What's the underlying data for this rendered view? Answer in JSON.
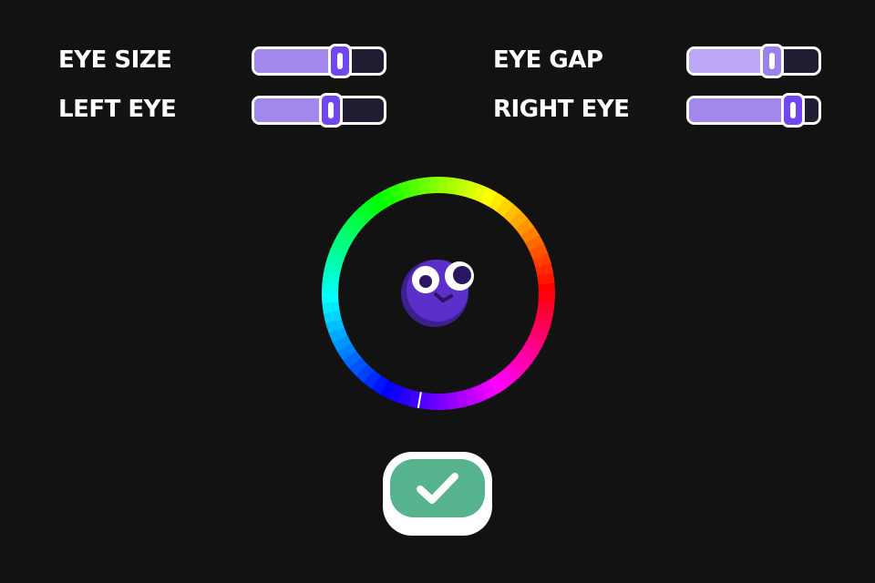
{
  "sliders": [
    {
      "id": "eye-size",
      "label": "EYE SIZE",
      "value": 0.66
    },
    {
      "id": "eye-gap",
      "label": "EYE GAP",
      "value": 0.64
    },
    {
      "id": "left-eye",
      "label": "LEFT EYE",
      "value": 0.59
    },
    {
      "id": "right-eye",
      "label": "RIGHT EYE",
      "value": 0.8
    }
  ],
  "color_wheel": {
    "selected_hue_deg": 260,
    "selected_color": "#5b2fc9"
  },
  "character": {
    "body_color": "#5b2fc9",
    "shadow_color": "#3f1f8f",
    "eye_white": "#ffffff",
    "pupil_color": "#2b1460"
  },
  "confirm_button": {
    "icon": "check-icon",
    "color": "#56b38d"
  }
}
